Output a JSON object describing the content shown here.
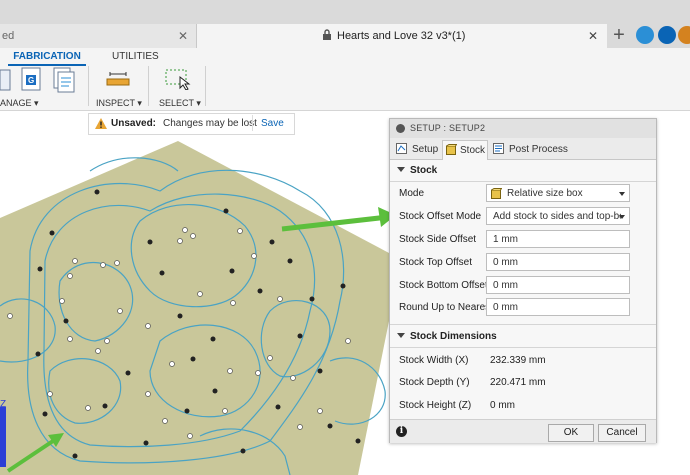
{
  "browser": {
    "left_tab_title": "ed",
    "active_tab_title": "Hearts and Love 32 v3*(1)"
  },
  "ribbon": {
    "tabs": [
      "FABRICATION",
      "UTILITIES"
    ],
    "groups": {
      "manage": "ANAGE",
      "inspect": "INSPECT",
      "select": "SELECT"
    }
  },
  "notice": {
    "label": "Unsaved:",
    "message": "Changes may be lost",
    "save_label": "Save"
  },
  "panel": {
    "title": "SETUP : SETUP2",
    "tabs": {
      "setup": "Setup",
      "stock": "Stock",
      "post": "Post Process"
    },
    "stock_section": "Stock",
    "mode": {
      "label": "Mode",
      "value": "Relative size box"
    },
    "offset_mode": {
      "label": "Stock Offset Mode",
      "value": "Add stock to sides and top-botto..."
    },
    "side_offset": {
      "label": "Stock Side Offset",
      "value": "1 mm"
    },
    "top_offset": {
      "label": "Stock Top Offset",
      "value": "0 mm"
    },
    "bottom_offset": {
      "label": "Stock Bottom Offset",
      "value": "0 mm"
    },
    "round_up": {
      "label": "Round Up to Nearest",
      "value": "0 mm"
    },
    "dims_section": "Stock Dimensions",
    "width": {
      "label": "Stock Width (X)",
      "value": "232.339 mm"
    },
    "depth": {
      "label": "Stock Depth (Y)",
      "value": "220.471 mm"
    },
    "height": {
      "label": "Stock Height (Z)",
      "value": "0 mm"
    },
    "ok_label": "OK",
    "cancel_label": "Cancel"
  },
  "axis": {
    "z_label": "Z"
  },
  "colors": {
    "accent": "#0a64b5",
    "arrow": "#5cbf3c",
    "stock": "#c9c79a",
    "toolpath": "#4aa3c4"
  }
}
